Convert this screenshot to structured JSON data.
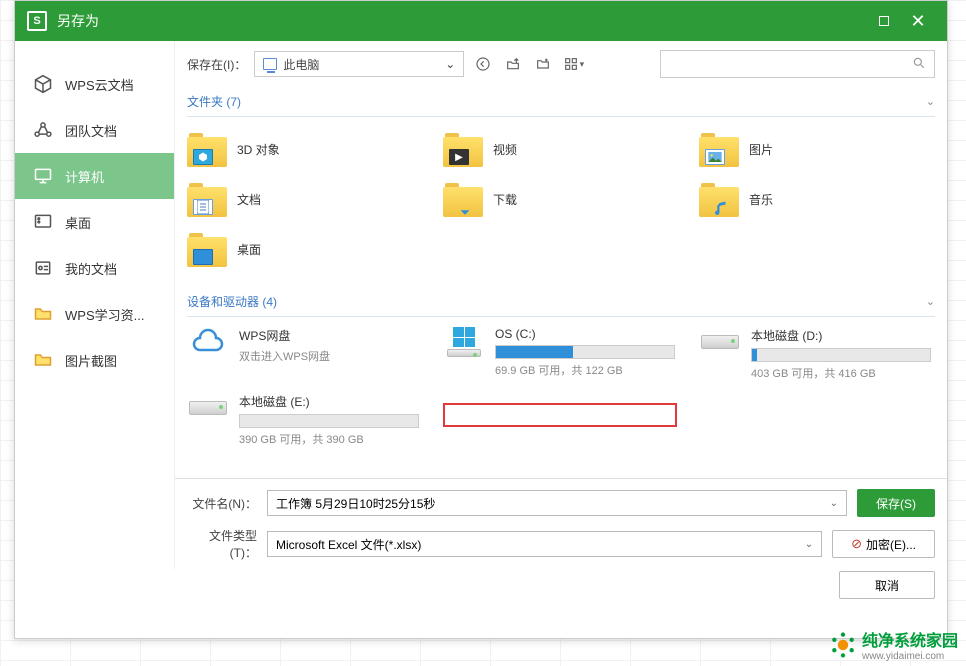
{
  "titlebar": {
    "title": "另存为"
  },
  "sidebar": {
    "items": [
      {
        "label": "WPS云文档",
        "icon": "cube-icon"
      },
      {
        "label": "团队文档",
        "icon": "share-icon"
      },
      {
        "label": "计算机",
        "icon": "monitor-icon",
        "active": true
      },
      {
        "label": "桌面",
        "icon": "grid-icon"
      },
      {
        "label": "我的文档",
        "icon": "doc-icon"
      },
      {
        "label": "WPS学习资...",
        "icon": "folder-icon"
      },
      {
        "label": "图片截图",
        "icon": "folder-icon"
      }
    ]
  },
  "toolbar": {
    "save_in_label": "保存在(I)：",
    "location": "此电脑"
  },
  "sections": {
    "folders_header": "文件夹 (7)",
    "drives_header": "设备和驱动器 (4)"
  },
  "folders": [
    {
      "name": "3D 对象"
    },
    {
      "name": "视频"
    },
    {
      "name": "图片"
    },
    {
      "name": "文档"
    },
    {
      "name": "下载"
    },
    {
      "name": "音乐"
    },
    {
      "name": "桌面"
    }
  ],
  "drives": {
    "wps": {
      "title": "WPS网盘",
      "sub": "双击进入WPS网盘"
    },
    "c": {
      "title": "OS (C:)",
      "sub": "69.9 GB 可用，共 122 GB",
      "fill_pct": 43
    },
    "d": {
      "title": "本地磁盘 (D:)",
      "sub": "403 GB 可用，共 416 GB",
      "fill_pct": 3
    },
    "e": {
      "title": "本地磁盘 (E:)",
      "sub": "390 GB 可用，共 390 GB",
      "fill_pct": 0
    }
  },
  "footer": {
    "filename_label": "文件名(N)：",
    "filename_value": "工作簿 5月29日10时25分15秒",
    "filetype_label": "文件类型(T)：",
    "filetype_value": "Microsoft Excel 文件(*.xlsx)",
    "save_btn": "保存(S)",
    "encrypt_btn": "加密(E)...",
    "cancel_btn": "取消"
  },
  "watermark": {
    "line1": "纯净系统家园",
    "line2": "www.yidaimei.com"
  }
}
